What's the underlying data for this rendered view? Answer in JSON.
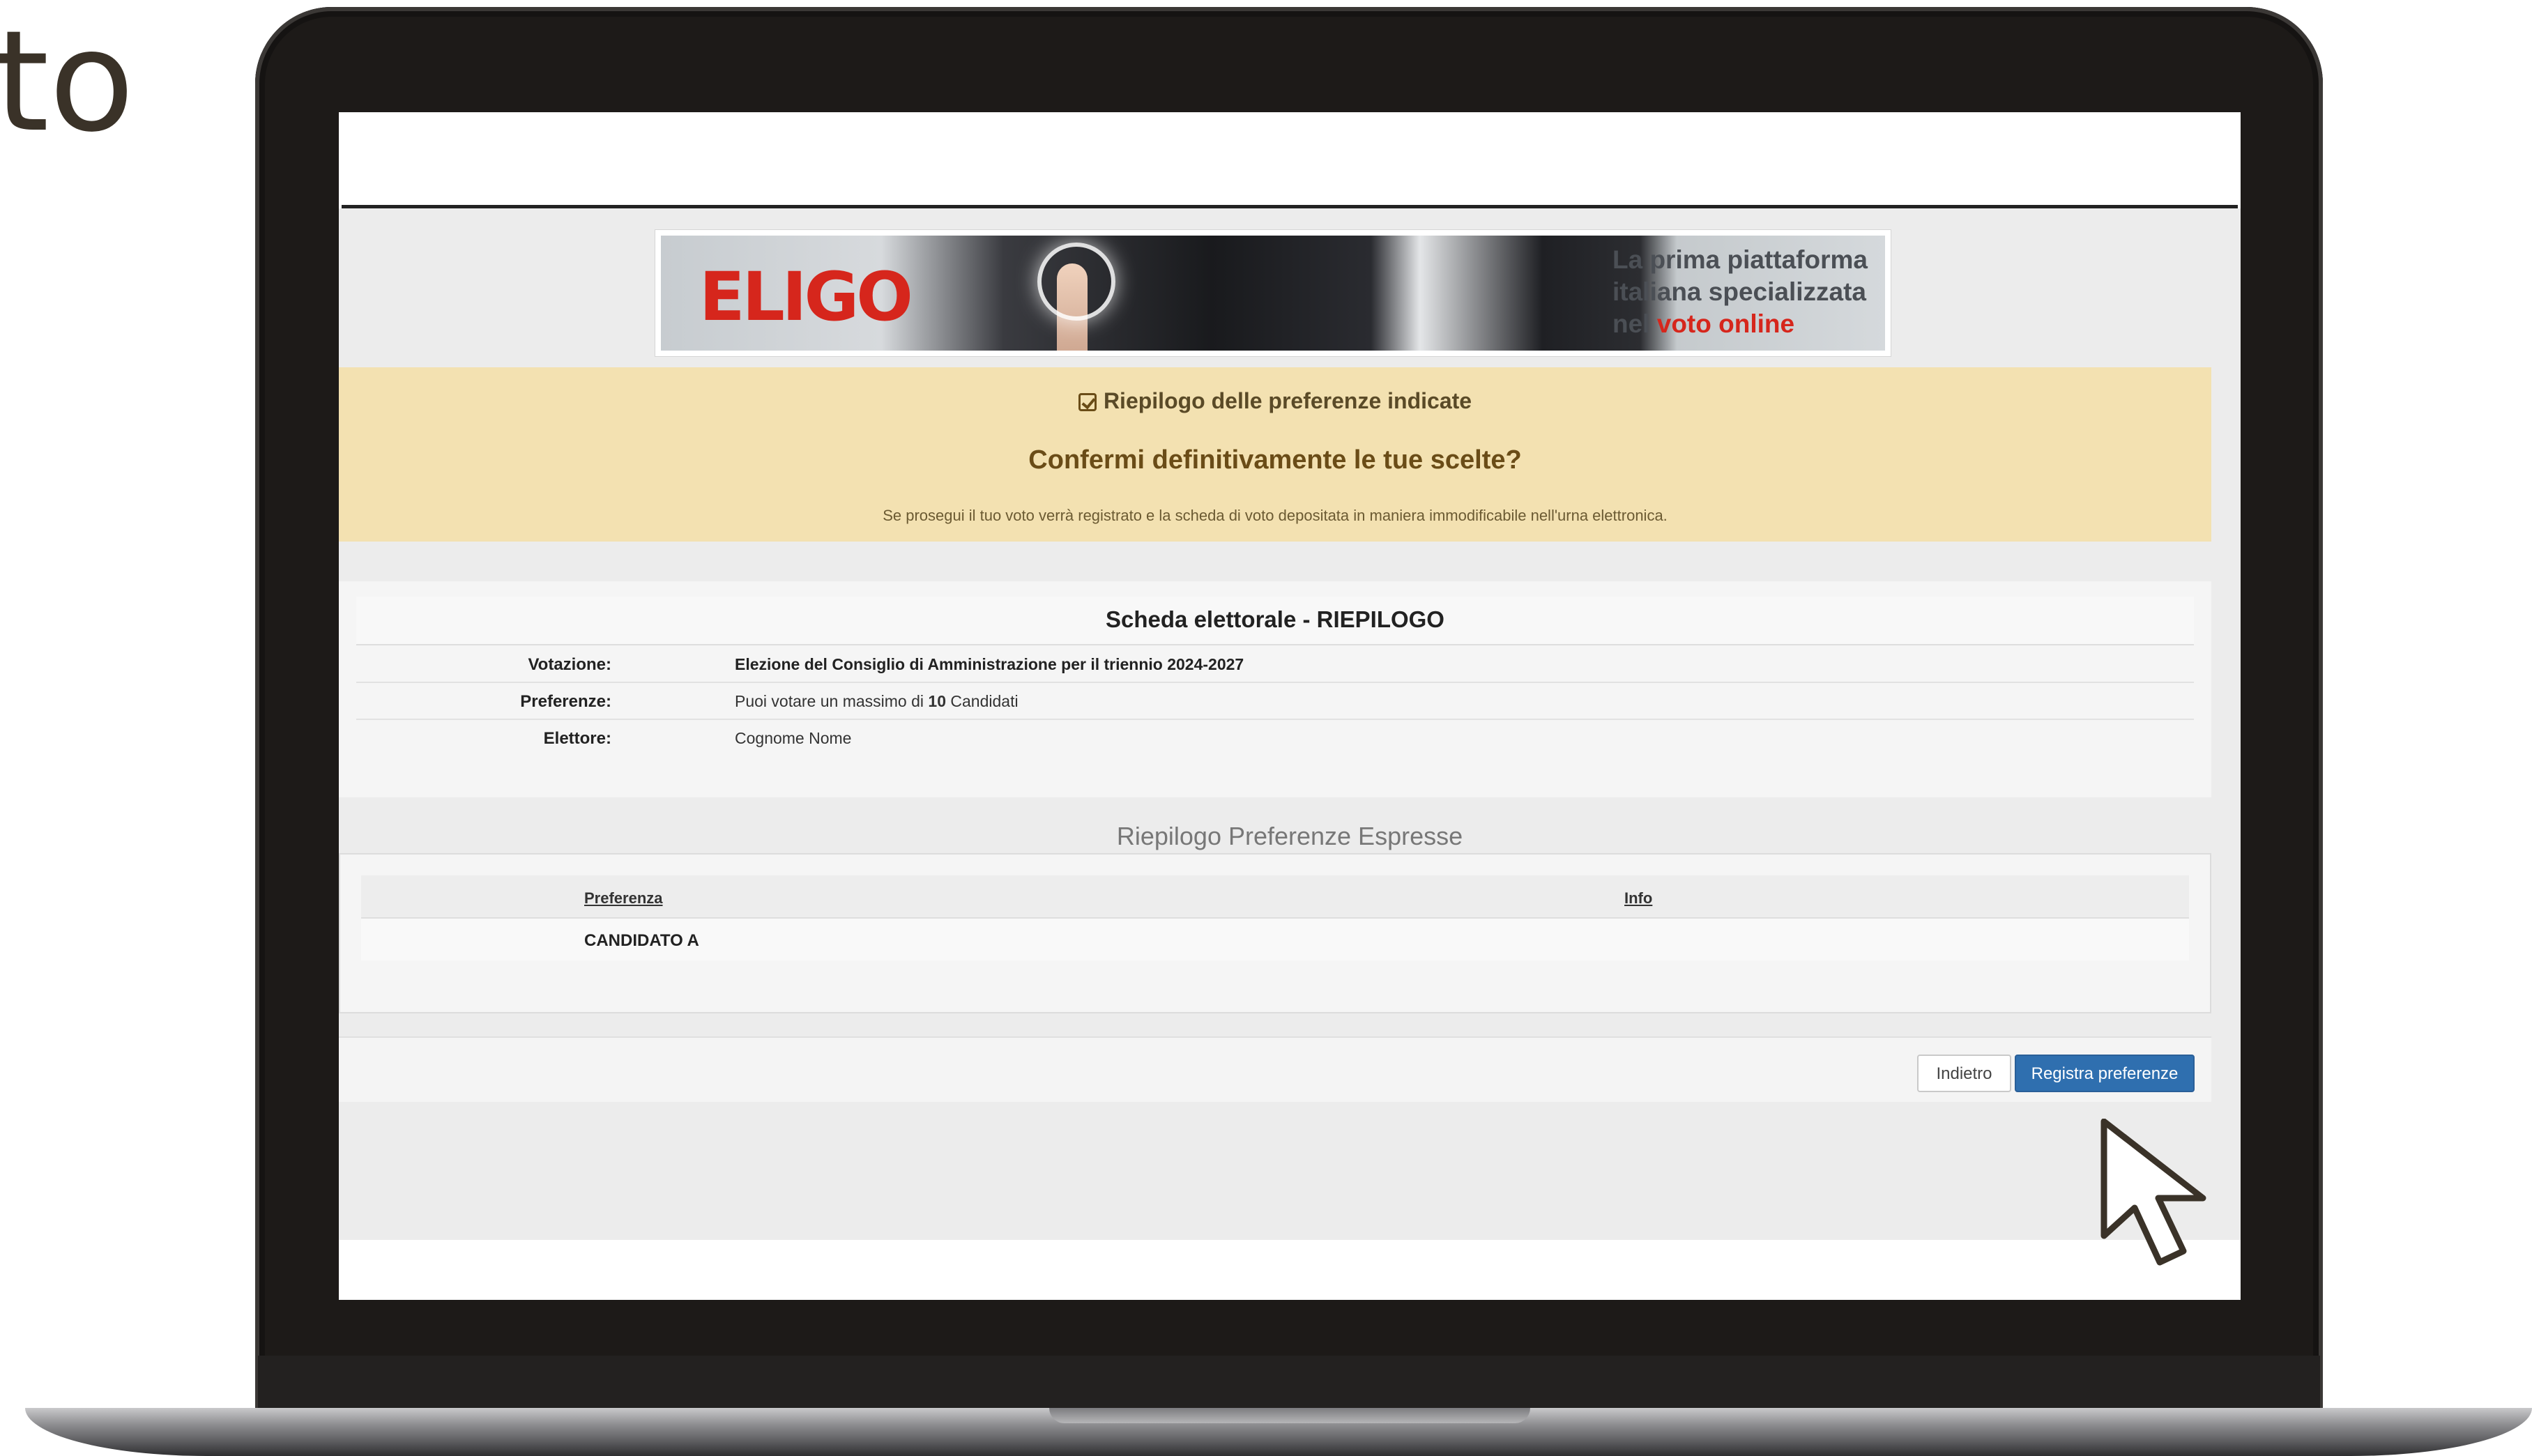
{
  "backdrop": {
    "partial_word": "to"
  },
  "banner": {
    "logo_text": "ELIGO",
    "tagline_line1": "La prima piattaforma",
    "tagline_line2": "italiana specializzata",
    "tagline_prefix": "nel ",
    "tagline_highlight": "voto online"
  },
  "notice": {
    "heading": "Riepilogo delle preferenze indicate",
    "question": "Confermi definitivamente le tue scelte?",
    "subtext": "Se prosegui il tuo voto verrà registrato e la scheda di voto depositata in maniera immodificabile nell'urna elettronica."
  },
  "ballot": {
    "title": "Scheda elettorale - RIEPILOGO",
    "votazione_label": "Votazione:",
    "votazione_value": "Elezione del Consiglio di Amministrazione per il triennio 2024-2027",
    "preferenze_label": "Preferenze:",
    "preferenze_prefix": "Puoi votare un massimo di ",
    "preferenze_count": "10",
    "preferenze_suffix": " Candidati",
    "elettore_label": "Elettore:",
    "elettore_value": "Cognome Nome"
  },
  "preferences": {
    "section_title": "Riepilogo Preferenze Espresse",
    "columns": [
      "Preferenza",
      "Info"
    ],
    "rows": [
      {
        "preferenza": "CANDIDATO A",
        "info": ""
      }
    ]
  },
  "actions": {
    "back_label": "Indietro",
    "save_label": "Registra preferenze"
  },
  "colors": {
    "notice_bg": "#f3e1b1",
    "primary_button": "#2f6faf",
    "brand_red": "#d6261c"
  },
  "icons": {
    "notice_heading": "check-square-icon",
    "pointer": "mouse-cursor-icon"
  }
}
